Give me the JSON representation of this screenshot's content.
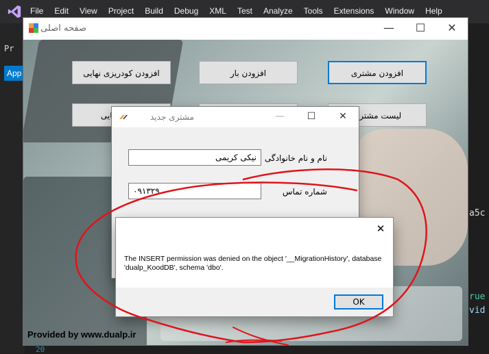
{
  "vs": {
    "menu": [
      "File",
      "Edit",
      "View",
      "Project",
      "Build",
      "Debug",
      "XML",
      "Test",
      "Analyze",
      "Tools",
      "Extensions",
      "Window",
      "Help"
    ],
    "tab_label": "App",
    "pr_label": "Pr",
    "code_snippets": {
      "right_a": "a5c",
      "right_true": "rue",
      "right_vid": "vid",
      "line_no": "20"
    }
  },
  "main_window": {
    "title": "صفحه اصلی",
    "buttons": {
      "add_customer": "افزودن مشتری",
      "add_cargo": "افزودن بار",
      "add_final_fertilizer": "افزودن کودریزی نهایی",
      "customer_list": "لیست مشتری",
      "final_fertilizer_partial": "دریزی نهایی"
    },
    "watermark": "Provided by www.dualp.ir"
  },
  "new_customer_window": {
    "title": "مشتری جدید",
    "fields": {
      "name_label": "نام و نام خانوادگی",
      "name_value": "نیکی کریمی",
      "phone_label": "شماره تماس",
      "phone_value": "۰۹۱۳۲۹"
    }
  },
  "message_box": {
    "text": "The INSERT permission was denied on the object '__MigrationHistory', database 'dualp_KoodDB', schema 'dbo'.",
    "ok_label": "OK",
    "close_symbol": "✕"
  },
  "colors": {
    "accent": "#0078d7",
    "annotation": "#e0141b",
    "vs_bar": "#2d2d30"
  }
}
